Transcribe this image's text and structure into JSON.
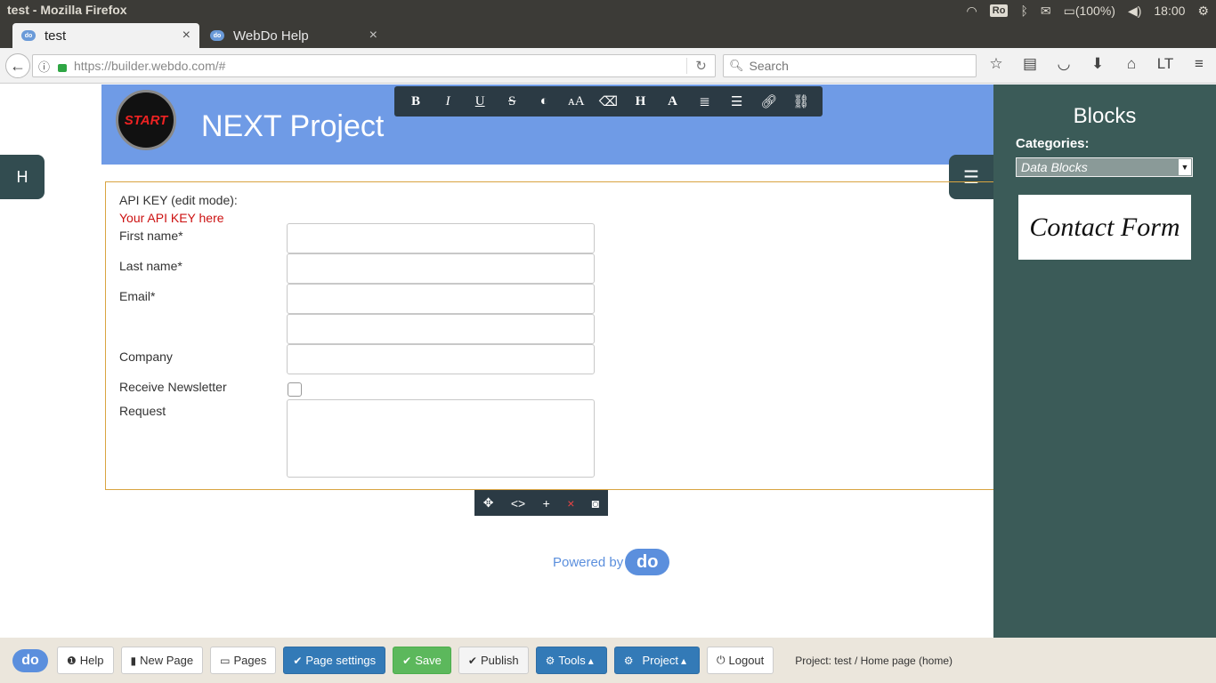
{
  "os": {
    "window_title": "test - Mozilla Firefox",
    "tray_ro": "Ro",
    "battery": "(100%)",
    "clock": "18:00"
  },
  "tabs": [
    {
      "label": "test",
      "favicon": "do"
    },
    {
      "label": "WebDo Help",
      "favicon": "do"
    }
  ],
  "navbar": {
    "url": "https://builder.webdo.com/#",
    "search_placeholder": "Search"
  },
  "page": {
    "logo_text": "START",
    "site_title": "NEXT Project",
    "side_tab_h": "H",
    "form": {
      "api_label": "API KEY (edit mode):",
      "api_value": "Your API KEY here",
      "first_name": "First name*",
      "last_name": "Last name*",
      "email": "Email*",
      "company": "Company",
      "newsletter": "Receive Newsletter",
      "request": "Request"
    },
    "powered_by": "Powered by",
    "powered_logo": "do"
  },
  "blocks_panel": {
    "title": "Blocks",
    "categories_label": "Categories:",
    "selected_category": "Data Blocks",
    "block_thumb": "Contact Form"
  },
  "bottom_bar": {
    "logo": "do",
    "help": "Help",
    "new_page": "New Page",
    "pages": "Pages",
    "page_settings": "Page settings",
    "save": "Save",
    "publish": "Publish",
    "tools": "Tools",
    "project": "Project",
    "logout": "Logout",
    "status": "Project: test / Home page (home)"
  },
  "colors": {
    "header_blue": "#6f9be6",
    "panel_teal": "#3b5b58",
    "toolbar_dark": "#2b3a44",
    "bootstrap_blue": "#337ab7",
    "bootstrap_green": "#5cb85c",
    "api_red": "#cc1111"
  }
}
